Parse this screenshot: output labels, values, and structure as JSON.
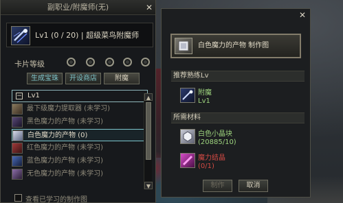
{
  "window_left": {
    "title": "副职业/附魔师(无)",
    "close_symbol": "✕",
    "header": {
      "icon": "enchanter-skill-icon",
      "text": "Lv1 (0 / 20) | 超级菜鸟附魔师"
    },
    "card_level_label": "卡片等级",
    "tabs": [
      {
        "label": "生成宝珠",
        "active": false
      },
      {
        "label": "开设商店",
        "active": false
      },
      {
        "label": "附魔",
        "active": true
      }
    ],
    "group": {
      "toggle": "−",
      "label": "Lv1"
    },
    "items": [
      {
        "label": "最下级魔力提取器 (未学习)",
        "icon": "extractor-icon",
        "selected": false
      },
      {
        "label": "黑色魔力的产物 (未学习)",
        "icon": "black-magic-icon",
        "selected": false
      },
      {
        "label": "白色魔力的产物 (0)",
        "icon": "white-magic-icon",
        "selected": true
      },
      {
        "label": "红色魔力的产物 (未学习)",
        "icon": "red-magic-icon",
        "selected": false
      },
      {
        "label": "蓝色魔力的产物 (未学习)",
        "icon": "blue-magic-icon",
        "selected": false
      },
      {
        "label": "无色魔力的产物 (未学习)",
        "icon": "colorless-magic-icon",
        "selected": false
      }
    ],
    "show_learned_label": "查看已学习的制作图"
  },
  "window_right": {
    "close_symbol": "✕",
    "recipe_title": "白色魔力的产物 制作图",
    "recommended_section": "推荐熟练Lv",
    "recommended": {
      "name": "附魔",
      "level": "Lv1"
    },
    "materials_section": "所需材料",
    "materials": [
      {
        "name": "白色小晶块",
        "amount": "(20885/10)",
        "name_color": "#9ed47e",
        "amount_color": "#9ed47e"
      },
      {
        "name": "魔力结晶",
        "amount": "(0/1)",
        "name_color": "#d44a44",
        "amount_color": "#d44a44"
      }
    ],
    "make_label": "制作",
    "cancel_label": "取消"
  }
}
